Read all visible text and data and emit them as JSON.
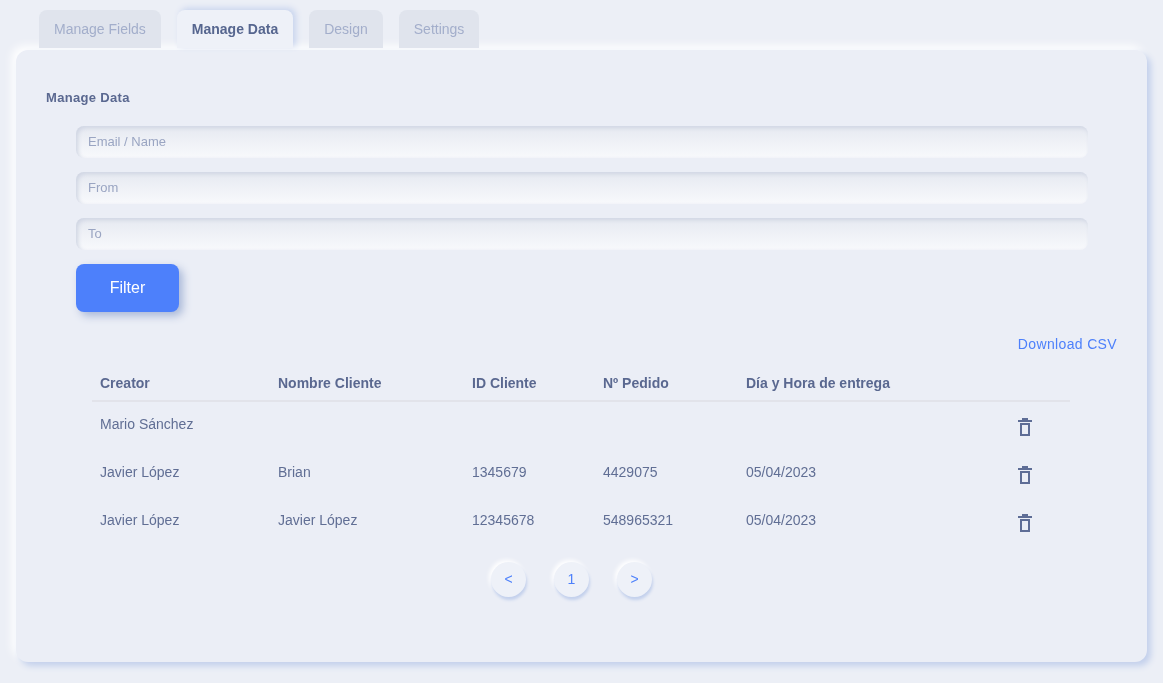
{
  "tabs": [
    {
      "label": "Manage Fields",
      "selected": false
    },
    {
      "label": "Manage Data",
      "selected": true
    },
    {
      "label": "Design",
      "selected": false
    },
    {
      "label": "Settings",
      "selected": false
    }
  ],
  "panel": {
    "title": "Manage Data",
    "fields": [
      {
        "placeholder": "Email / Name"
      },
      {
        "placeholder": "From"
      },
      {
        "placeholder": "To"
      }
    ],
    "filter_button": "Filter",
    "download_link": "Download CSV",
    "table": {
      "columns": [
        "Creator",
        "Nombre Cliente",
        "ID Cliente",
        "Nº Pedido",
        "Día y Hora de entrega"
      ],
      "rows": [
        {
          "cells": [
            "Mario Sánchez",
            "",
            "",
            "",
            ""
          ]
        },
        {
          "cells": [
            "Javier López",
            "Brian",
            "1345679",
            "4429075",
            "05/04/2023"
          ]
        },
        {
          "cells": [
            "Javier López",
            "Javier López",
            "12345678",
            "548965321",
            "05/04/2023"
          ]
        }
      ]
    },
    "pagination": {
      "previous": "<",
      "pages": [
        "1"
      ],
      "next": ">"
    }
  }
}
